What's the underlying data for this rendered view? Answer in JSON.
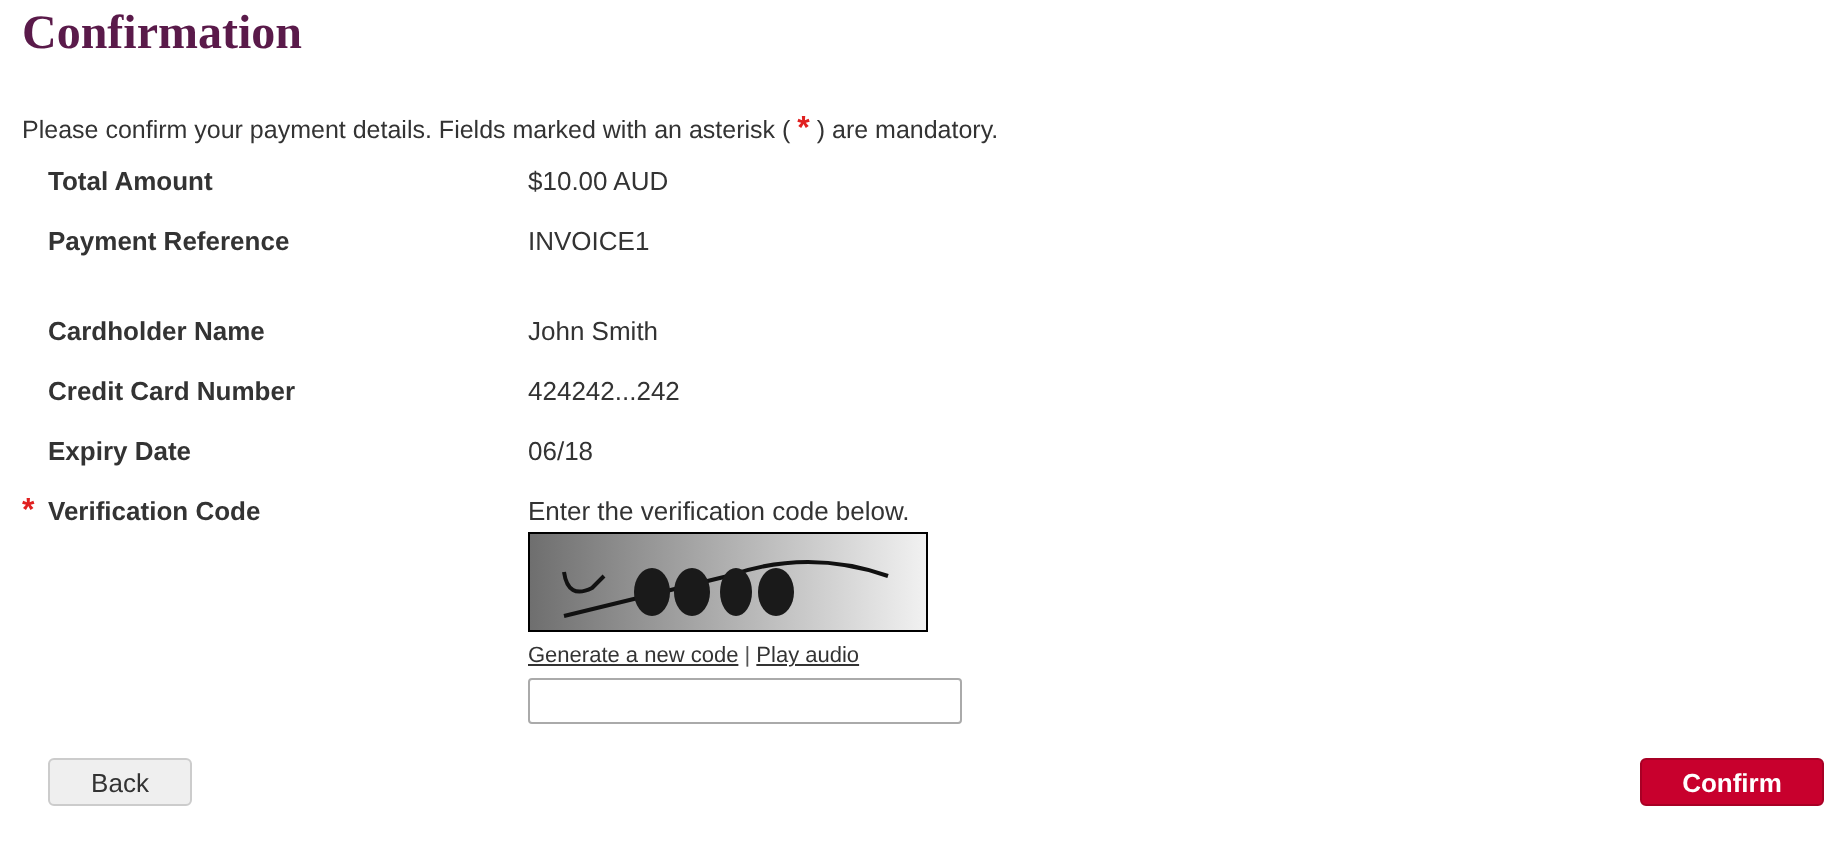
{
  "title": "Confirmation",
  "intro": {
    "before": "Please confirm your payment details. Fields marked with an asterisk (",
    "mark": "*",
    "after": ") are mandatory."
  },
  "groups": [
    [
      {
        "label": "Total Amount",
        "value": "$10.00 AUD"
      },
      {
        "label": "Payment Reference",
        "value": "INVOICE1"
      }
    ],
    [
      {
        "label": "Cardholder Name",
        "value": "John Smith"
      },
      {
        "label": "Credit Card Number",
        "value": "424242...242"
      },
      {
        "label": "Expiry Date",
        "value": "06/18"
      }
    ]
  ],
  "verification": {
    "required_mark": "*",
    "label": "Verification Code",
    "instruction": "Enter the verification code below.",
    "captcha": {
      "kind": "picture"
    },
    "links": [
      "Generate a new code",
      "Play audio"
    ],
    "separator": "|"
  },
  "buttons": [
    {
      "kind": "secondary",
      "label": "Back"
    },
    {
      "kind": "primary",
      "label": "Confirm"
    }
  ]
}
